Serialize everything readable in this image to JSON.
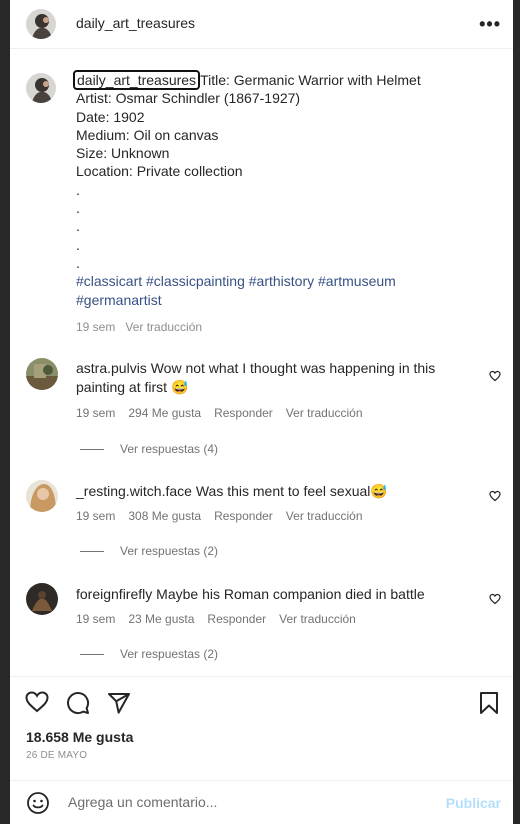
{
  "header": {
    "username": "daily_art_treasures",
    "more_label": "•••"
  },
  "caption": {
    "username": "daily_art_treasures",
    "lines": [
      "Title: Germanic Warrior with Helmet",
      "Artist: Osmar Schindler (1867-1927)",
      "Date: 1902",
      "Medium: Oil on canvas",
      "Size: Unknown",
      "Location: Private collection",
      ".",
      ".",
      ".",
      ".",
      "."
    ],
    "hashtags_line1": "#classicart #classicpainting #arthistory #artmuseum",
    "hashtags_line2": "#germanartist",
    "time": "19 sem",
    "translate": "Ver traducción"
  },
  "comments": [
    {
      "username": "astra.pulvis",
      "text_line1": "Wow not what I thought was happening in this",
      "text_line2": "painting at first 😅",
      "time": "19 sem",
      "likes": "294 Me gusta",
      "reply": "Responder",
      "translate": "Ver traducción",
      "replies": "Ver respuestas (4)"
    },
    {
      "username": "_resting.witch.face",
      "text_line1": "Was this ment to feel sexual😅",
      "time": "19 sem",
      "likes": "308 Me gusta",
      "reply": "Responder",
      "translate": "Ver traducción",
      "replies": "Ver respuestas (2)"
    },
    {
      "username": "foreignfirefly",
      "text_line1": "Maybe his Roman companion died in battle",
      "time": "19 sem",
      "likes": "23 Me gusta",
      "reply": "Responder",
      "translate": "Ver traducción",
      "replies": "Ver respuestas (2)"
    }
  ],
  "footer": {
    "likes": "18.658 Me gusta",
    "date": "26 DE MAYO",
    "comment_placeholder": "Agrega un comentario...",
    "post_label": "Publicar"
  },
  "icons": {
    "like": "heart-icon",
    "comment": "comment-bubble-icon",
    "share": "paper-plane-icon",
    "save": "bookmark-icon",
    "emoji": "emoji-smile-icon",
    "more": "more-dots-icon"
  },
  "colors": {
    "hashtag": "#385185",
    "meta": "#8e8e8e",
    "post_button": "#b2dffc"
  }
}
